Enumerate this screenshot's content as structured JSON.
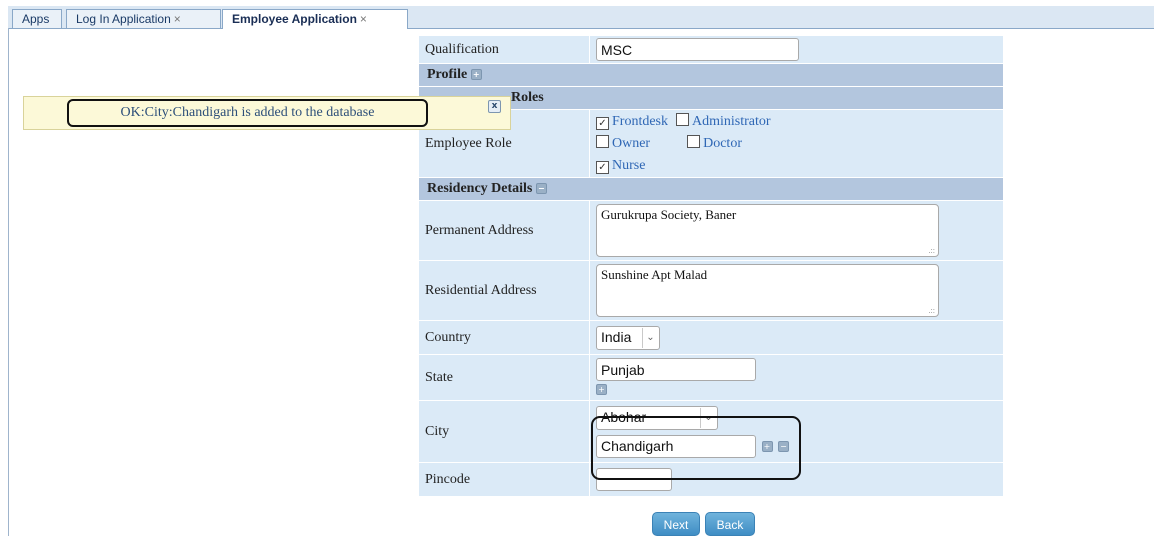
{
  "tabs": [
    {
      "label": "Apps"
    },
    {
      "label": "Log In Application",
      "close": "×"
    },
    {
      "label": "Employee Application",
      "close": "×"
    }
  ],
  "notification": {
    "message": "OK:City:Chandigarh is added to the database",
    "close": "x"
  },
  "form": {
    "qualification": {
      "label": "Qualification",
      "value": "MSC"
    },
    "profile_section": {
      "label": "Profile"
    },
    "roles_section": {
      "label": "Roles"
    },
    "employee_role": {
      "label": "Employee Role",
      "options": [
        {
          "label": "Frontdesk",
          "checked": true
        },
        {
          "label": "Administrator",
          "checked": false
        },
        {
          "label": "Owner",
          "checked": false
        },
        {
          "label": "Doctor",
          "checked": false
        },
        {
          "label": "Nurse",
          "checked": true
        }
      ]
    },
    "residency_section": {
      "label": "Residency Details"
    },
    "permanent_address": {
      "label": "Permanent Address",
      "value": "Gurukrupa Society, Baner"
    },
    "residential_address": {
      "label": "Residential Address",
      "value": "Sunshine Apt Malad"
    },
    "country": {
      "label": "Country",
      "value": "India"
    },
    "state": {
      "label": "State",
      "value": "Punjab"
    },
    "city": {
      "label": "City",
      "selected": "Abohar",
      "new_value": "Chandigarh"
    },
    "pincode": {
      "label": "Pincode",
      "value": ""
    }
  },
  "buttons": {
    "next": "Next",
    "back": "Back"
  },
  "icons": {
    "expand": "plus-icon",
    "collapse": "minus-icon",
    "dropdown": "chevron-down-icon",
    "check": "checkmark-icon"
  },
  "colors": {
    "section_header": "#b3c6de",
    "row_bg": "#dbeaf7",
    "link_blue": "#2f67b5",
    "button": "#3f8dc4"
  }
}
